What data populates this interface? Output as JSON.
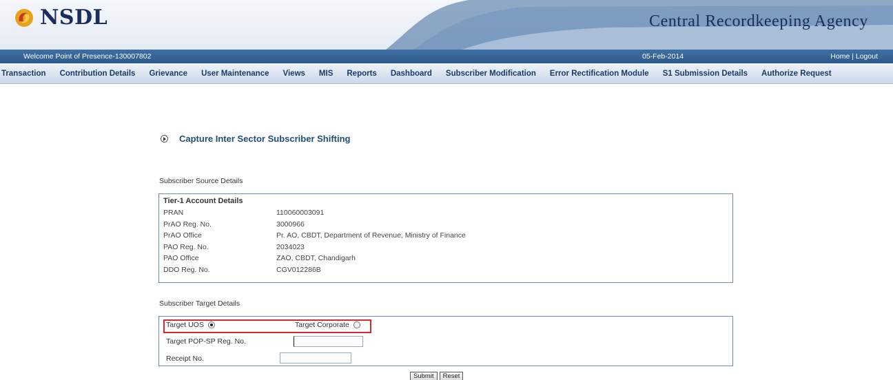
{
  "header": {
    "logo_text": "NSDL",
    "agency_name": "Central Recordkeeping Agency"
  },
  "welcome_bar": {
    "welcome_text": "Welcome Point of Presence-130007802",
    "date": "05-Feb-2014",
    "home_label": "Home",
    "separator": " | ",
    "logout_label": "Logout"
  },
  "menu": {
    "items": [
      "Transaction",
      "Contribution Details",
      "Grievance",
      "User Maintenance",
      "Views",
      "MIS",
      "Reports",
      "Dashboard",
      "Subscriber Modification",
      "Error Rectification Module",
      "S1 Submission Details",
      "Authorize Request"
    ]
  },
  "page": {
    "title": "Capture Inter Sector Subscriber Shifting",
    "source_section_label": "Subscriber Source Details",
    "target_section_label": "Subscriber Target Details"
  },
  "source_details": {
    "box_title": "Tier-1 Account Details",
    "rows": [
      {
        "label": "PRAN",
        "value": "110060003091"
      },
      {
        "label": "PrAO Reg. No.",
        "value": "3000966"
      },
      {
        "label": "PrAO Office",
        "value": "Pr. AO, CBDT, Department of Revenue, Ministry of Finance"
      },
      {
        "label": "PAO Reg. No.",
        "value": "2034023"
      },
      {
        "label": "PAO Office",
        "value": "ZAO, CBDT, Chandigarh"
      },
      {
        "label": "DDO Reg. No.",
        "value": "CGV012286B"
      }
    ]
  },
  "target_details": {
    "target_uos_label": "Target UOS",
    "target_uos_selected": true,
    "target_corporate_label": "Target Corporate",
    "target_corporate_selected": false,
    "pop_sp_label": "Target POP-SP Reg. No.",
    "pop_sp_value": "",
    "receipt_label": "Receipt No.",
    "receipt_value": ""
  },
  "buttons": {
    "submit_label": "Submit",
    "reset_label": "Reset"
  },
  "colors": {
    "brand_navy": "#1b2d5c",
    "welcome_bar": "#2d5a8c",
    "title_blue": "#1f4e79",
    "highlight_red": "#d9272e"
  }
}
